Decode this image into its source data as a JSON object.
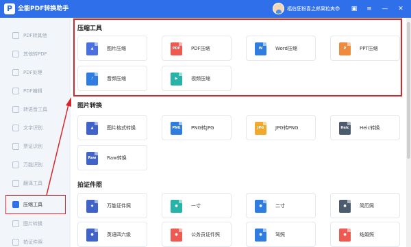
{
  "app": {
    "title": "全能PDF转换助手",
    "logo_glyph": "P",
    "user_name": "福伯狂粉喜之郎果粒爽😎"
  },
  "titlebar_icons": [
    {
      "name": "app-icon",
      "glyph": "▣"
    },
    {
      "name": "menu-icon",
      "glyph": "≡"
    },
    {
      "name": "minimize-icon",
      "glyph": "—"
    },
    {
      "name": "close-icon",
      "glyph": "✕"
    }
  ],
  "sidebar": {
    "items": [
      {
        "label": "PDF转其他"
      },
      {
        "label": "其他转PDF"
      },
      {
        "label": "PDF处理"
      },
      {
        "label": "PDF编辑"
      },
      {
        "label": "转语音工具"
      },
      {
        "label": "文字识别"
      },
      {
        "label": "票证识别"
      },
      {
        "label": "万能识别"
      },
      {
        "label": "翻译工具"
      },
      {
        "label": "压缩工具",
        "active": true
      },
      {
        "label": "图片转换"
      },
      {
        "label": "拍证件照"
      }
    ]
  },
  "sections": {
    "compress": {
      "title": "压缩工具"
    },
    "image_convert": {
      "title": "图片转换"
    },
    "id_photo": {
      "title": "拍证件照"
    }
  },
  "cards": {
    "compress": [
      {
        "label": "图片压缩",
        "icon": "image-icon",
        "icon_text": "▲",
        "color": "#4a6fe0"
      },
      {
        "label": "PDF压缩",
        "icon": "pdf-icon",
        "icon_text": "PDF",
        "color": "#ee5a52"
      },
      {
        "label": "Word压缩",
        "icon": "word-icon",
        "icon_text": "W",
        "color": "#2f7de1"
      },
      {
        "label": "PPT压缩",
        "icon": "ppt-icon",
        "icon_text": "P",
        "color": "#f08a3c"
      },
      {
        "label": "音频压缩",
        "icon": "audio-icon",
        "icon_text": "♪",
        "color": "#2f7de1"
      },
      {
        "label": "视频压缩",
        "icon": "video-icon",
        "icon_text": "▶",
        "color": "#27b3a8"
      }
    ],
    "image_convert": [
      {
        "label": "图片格式转换",
        "icon": "image-format-icon",
        "icon_text": "▲",
        "color": "#3f63c9"
      },
      {
        "label": "PNG转JPG",
        "icon": "png-icon",
        "icon_text": "PNG",
        "color": "#2f7de1"
      },
      {
        "label": "JPG转PNG",
        "icon": "jpg-icon",
        "icon_text": "JPG",
        "color": "#f0a92c"
      },
      {
        "label": "Heic转换",
        "icon": "heic-icon",
        "icon_text": "Heic",
        "color": "#4d5b6e"
      },
      {
        "label": "Raw转换",
        "icon": "raw-icon",
        "icon_text": "Raw",
        "color": "#3f63c9"
      }
    ],
    "id_photo": [
      {
        "label": "万能证件照",
        "icon": "id-photo-icon",
        "icon_text": "◆",
        "color": "#3f63c9"
      },
      {
        "label": "一寸",
        "icon": "one-inch-icon",
        "icon_text": "●",
        "color": "#27b3a8"
      },
      {
        "label": "二寸",
        "icon": "two-inch-icon",
        "icon_text": "●",
        "color": "#2f7de1"
      },
      {
        "label": "简历照",
        "icon": "resume-photo-icon",
        "icon_text": "●",
        "color": "#4d5b6e"
      },
      {
        "label": "英语四六级",
        "icon": "cet-photo-icon",
        "icon_text": "●",
        "color": "#3f63c9"
      },
      {
        "label": "公务员证件照",
        "icon": "civil-servant-photo-icon",
        "icon_text": "●",
        "color": "#ee5a52"
      },
      {
        "label": "驾照",
        "icon": "driver-license-photo-icon",
        "icon_text": "●",
        "color": "#2f7de1"
      },
      {
        "label": "结婚照",
        "icon": "wedding-photo-icon",
        "icon_text": "●",
        "color": "#ee5a52"
      }
    ]
  }
}
